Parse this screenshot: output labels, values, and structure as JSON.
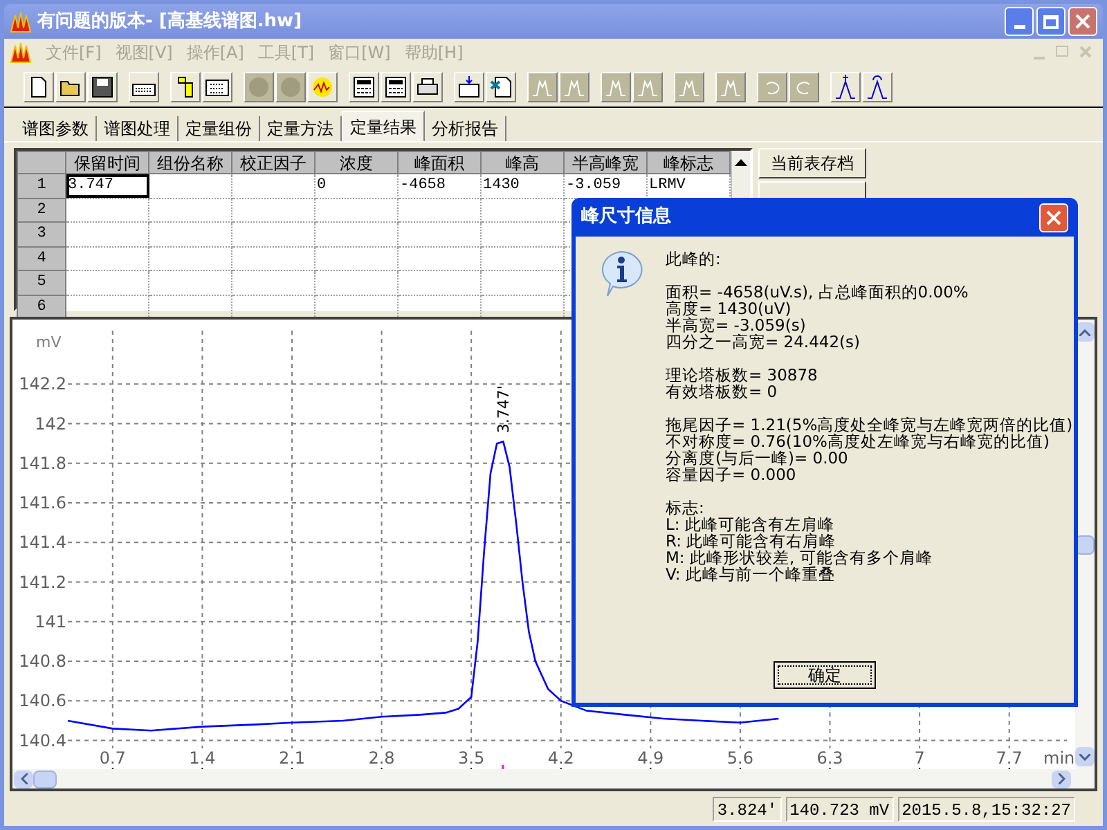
{
  "window": {
    "title": "有问题的版本- [高基线谱图.hw]"
  },
  "menu": [
    "文件[F]",
    "视图[V]",
    "操作[A]",
    "工具[T]",
    "窗口[W]",
    "帮助[H]"
  ],
  "toolbar": [
    {
      "buttons": [
        {
          "kind": "new",
          "disabled": false
        },
        {
          "kind": "open",
          "disabled": false
        },
        {
          "kind": "save",
          "disabled": false
        }
      ]
    },
    {
      "buttons": [
        {
          "kind": "keyboard",
          "disabled": false
        }
      ]
    },
    {
      "buttons": [
        {
          "kind": "list",
          "disabled": false
        },
        {
          "kind": "grid",
          "disabled": false
        }
      ]
    },
    {
      "buttons": [
        {
          "kind": "circle",
          "disabled": true
        },
        {
          "kind": "circle",
          "disabled": true
        },
        {
          "kind": "wave-circle",
          "disabled": false
        }
      ]
    },
    {
      "buttons": [
        {
          "kind": "calculator",
          "disabled": false
        },
        {
          "kind": "calculator",
          "disabled": false
        },
        {
          "kind": "printer",
          "disabled": false
        }
      ]
    },
    {
      "buttons": [
        {
          "kind": "table-in",
          "disabled": false
        },
        {
          "kind": "table-out",
          "disabled": false
        }
      ]
    },
    {
      "buttons": [
        {
          "kind": "peak",
          "disabled": true
        },
        {
          "kind": "peak",
          "disabled": true
        }
      ]
    },
    {
      "buttons": [
        {
          "kind": "peak",
          "disabled": true
        },
        {
          "kind": "peak",
          "disabled": true
        }
      ]
    },
    {
      "buttons": [
        {
          "kind": "peak",
          "disabled": true
        }
      ]
    },
    {
      "buttons": [
        {
          "kind": "peak",
          "disabled": true
        }
      ]
    },
    {
      "buttons": [
        {
          "kind": "undo",
          "disabled": true
        },
        {
          "kind": "redo",
          "disabled": true
        }
      ]
    },
    {
      "buttons": [
        {
          "kind": "peak-add",
          "disabled": false
        },
        {
          "kind": "peak-edit",
          "disabled": false
        }
      ]
    }
  ],
  "tabs": [
    {
      "label": "谱图参数",
      "selected": false
    },
    {
      "label": "谱图处理",
      "selected": false
    },
    {
      "label": "定量组份",
      "selected": false
    },
    {
      "label": "定量方法",
      "selected": false
    },
    {
      "label": "定量结果",
      "selected": true
    },
    {
      "label": "分析报告",
      "selected": false
    }
  ],
  "table": {
    "columns": [
      "保留时间",
      "组份名称",
      "校正因子",
      "浓度",
      "峰面积",
      "峰高",
      "半高峰宽",
      "峰标志"
    ],
    "rows": [
      {
        "number": "1",
        "cells": [
          "3.747",
          "",
          "",
          "0",
          "-4658",
          "1430",
          "-3.059",
          "LRMV"
        ]
      },
      {
        "number": "2",
        "cells": []
      },
      {
        "number": "3",
        "cells": []
      },
      {
        "number": "4",
        "cells": []
      },
      {
        "number": "5",
        "cells": []
      },
      {
        "number": "6",
        "cells": []
      }
    ]
  },
  "side_buttons": [
    "当前表存档"
  ],
  "chromatogram": {
    "chart_data": {
      "type": "line",
      "grid": true,
      "xlabel": "min",
      "ylabel": "mV",
      "xlim": [
        0.35,
        8.15
      ],
      "ylim": [
        140.36,
        142.47
      ],
      "xticks": [
        0.7,
        1.4,
        2.1,
        2.8,
        3.5,
        4.2,
        4.9,
        5.6,
        6.3,
        7,
        7.7
      ],
      "yticks": [
        140.4,
        140.6,
        140.8,
        141,
        141.2,
        141.4,
        141.6,
        141.8,
        142,
        142.2
      ],
      "x": [
        0.35,
        0.7,
        1.0,
        1.4,
        1.8,
        2.1,
        2.5,
        2.8,
        3.1,
        3.3,
        3.4,
        3.5,
        3.55,
        3.6,
        3.65,
        3.7,
        3.75,
        3.8,
        3.85,
        3.9,
        3.95,
        4.0,
        4.1,
        4.2,
        4.4,
        4.7,
        5.0,
        5.3,
        5.6,
        5.9
      ],
      "series": [
        {
          "color": "#0000ff",
          "values": [
            140.5,
            140.46,
            140.45,
            140.47,
            140.48,
            140.49,
            140.5,
            140.52,
            140.53,
            140.54,
            140.56,
            140.62,
            140.9,
            141.35,
            141.75,
            141.9,
            141.91,
            141.78,
            141.5,
            141.2,
            140.95,
            140.8,
            140.66,
            140.6,
            140.55,
            140.53,
            140.51,
            140.5,
            140.49,
            140.51
          ]
        }
      ],
      "annotations": [
        {
          "x": 3.747,
          "y": 141.91,
          "text": "3.747'"
        }
      ]
    }
  },
  "status_bar": [
    "3.824'",
    "140.723 mV",
    "2015.5.8,15:32:27"
  ],
  "dialog": {
    "title": "峰尺寸信息",
    "paragraphs": [
      [
        "此峰的:"
      ],
      [
        "面积= -4658(uV.s), 占总峰面积的0.00%",
        "高度= 1430(uV)",
        "半高宽= -3.059(s)",
        "四分之一高宽= 24.442(s)"
      ],
      [
        "理论塔板数= 30878",
        "有效塔板数= 0"
      ],
      [
        "拖尾因子= 1.21(5%高度处全峰宽与左峰宽两倍的比值)",
        "不对称度= 0.76(10%高度处左峰宽与右峰宽的比值)",
        "分离度(与后一峰)= 0.00",
        "容量因子= 0.000"
      ],
      [
        "标志:",
        "L: 此峰可能含有左肩峰",
        "R: 此峰可能含有右肩峰",
        "M: 此峰形状较差, 可能含有多个肩峰",
        "V: 此峰与前一个峰重叠"
      ]
    ],
    "ok_button": "确定"
  }
}
